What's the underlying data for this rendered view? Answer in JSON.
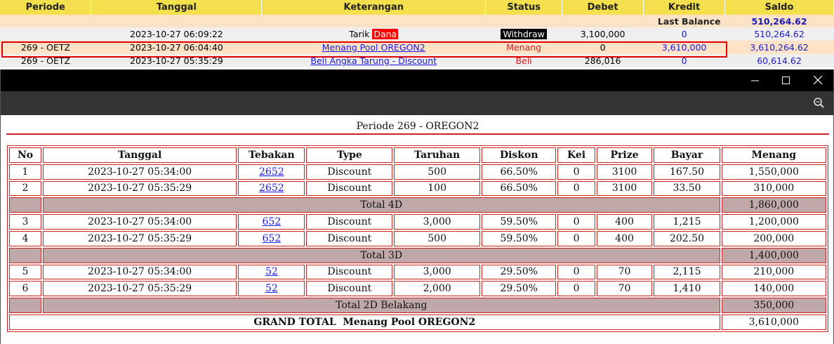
{
  "header": {
    "periode": "Periode",
    "tanggal": "Tanggal",
    "keterangan": "Keterangan",
    "status": "Status",
    "debet": "Debet",
    "kredit": "Kredit",
    "saldo": "Saldo"
  },
  "last_balance": {
    "label": "Last Balance",
    "value": "510,264.62"
  },
  "transactions": [
    {
      "periode": "",
      "tanggal": "2023-10-27 06:09:22",
      "ket_prefix": "Tarik",
      "ket_badge": "Dana",
      "status": "Withdraw",
      "debet": "3,100,000",
      "kredit": "0",
      "saldo": "510,264.62"
    },
    {
      "periode": "269 - OETZ",
      "tanggal": "2023-10-27 06:04:40",
      "ket_link": "Menang Pool OREGON2",
      "status": "Menang",
      "debet": "0",
      "kredit": "3,610,000",
      "saldo": "3,610,264.62"
    },
    {
      "periode": "269 - OETZ",
      "tanggal": "2023-10-27 05:35:29",
      "ket_link": "Beli Angka Tarung - Discount",
      "status": "Beli",
      "debet": "286,016",
      "kredit": "0",
      "saldo": "60,614.62"
    }
  ],
  "popup": {
    "title": "Periode 269 - OREGON2",
    "columns": [
      "No",
      "Tanggal",
      "Tebakan",
      "Type",
      "Taruhan",
      "Diskon",
      "Kei",
      "Prize",
      "Bayar",
      "Menang"
    ],
    "rows": [
      {
        "no": "1",
        "tanggal": "2023-10-27 05:34:00",
        "tebakan": "2652",
        "type": "Discount",
        "taruhan": "500",
        "diskon": "66.50%",
        "kei": "0",
        "prize": "3100",
        "bayar": "167.50",
        "menang": "1,550,000"
      },
      {
        "no": "2",
        "tanggal": "2023-10-27 05:35:29",
        "tebakan": "2652",
        "type": "Discount",
        "taruhan": "100",
        "diskon": "66.50%",
        "kei": "0",
        "prize": "3100",
        "bayar": "33.50",
        "menang": "310,000"
      },
      {
        "total_label": "Total 4D",
        "total_value": "1,860,000"
      },
      {
        "no": "3",
        "tanggal": "2023-10-27 05:34:00",
        "tebakan": "652",
        "type": "Discount",
        "taruhan": "3,000",
        "diskon": "59.50%",
        "kei": "0",
        "prize": "400",
        "bayar": "1,215",
        "menang": "1,200,000"
      },
      {
        "no": "4",
        "tanggal": "2023-10-27 05:35:29",
        "tebakan": "652",
        "type": "Discount",
        "taruhan": "500",
        "diskon": "59.50%",
        "kei": "0",
        "prize": "400",
        "bayar": "202.50",
        "menang": "200,000"
      },
      {
        "total_label": "Total 3D",
        "total_value": "1,400,000"
      },
      {
        "no": "5",
        "tanggal": "2023-10-27 05:34:00",
        "tebakan": "52",
        "type": "Discount",
        "taruhan": "3,000",
        "diskon": "29.50%",
        "kei": "0",
        "prize": "70",
        "bayar": "2,115",
        "menang": "210,000"
      },
      {
        "no": "6",
        "tanggal": "2023-10-27 05:35:29",
        "tebakan": "52",
        "type": "Discount",
        "taruhan": "2,000",
        "diskon": "29.50%",
        "kei": "0",
        "prize": "70",
        "bayar": "1,410",
        "menang": "140,000"
      },
      {
        "total_label": "Total 2D Belakang",
        "total_value": "350,000"
      }
    ],
    "grand_total": {
      "label": "GRAND TOTAL  Menang Pool OREGON2",
      "value": "3,610,000"
    }
  },
  "icons": {
    "minimize": "minimize-icon",
    "maximize": "maximize-icon",
    "close": "close-icon",
    "zoom": "zoom-icon"
  },
  "colors": {
    "header_bg": "#f4e04d",
    "highlight": "#fde2c6",
    "total_bg": "#c0a8a8",
    "border_red": "#cc2222",
    "link": "#1a1ae0"
  }
}
